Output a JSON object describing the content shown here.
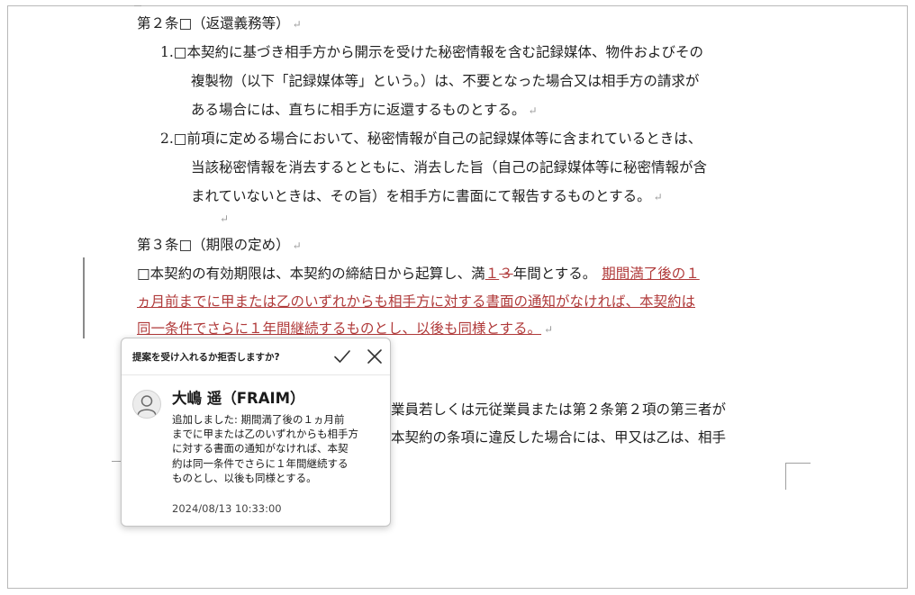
{
  "document": {
    "article2": {
      "heading": "第２条□（返還義務等）",
      "item1": {
        "number": "1.□",
        "lines": [
          "本契約に基づき相手方から開示を受けた秘密情報を含む記録媒体、物件およびその",
          "複製物（以下「記録媒体等」という。）は、不要となった場合又は相手方の請求が",
          "ある場合には、直ちに相手方に返還するものとする。"
        ]
      },
      "item2": {
        "number": "2.□",
        "lines": [
          "前項に定める場合において、秘密情報が自己の記録媒体等に含まれているときは、",
          "当該秘密情報を消去するとともに、消去した旨（自己の記録媒体等に秘密情報が含",
          "まれていないときは、その旨）を相手方に書面にて報告するものとする。"
        ]
      }
    },
    "article3": {
      "heading": "第３条□（期限の定め）",
      "line1_prefix": "□本契約の有効期限は、本契約の締結日から起算し、満",
      "line1_inserted_num": "１",
      "line1_deleted_num": "３",
      "line1_suffix": "年間とする。",
      "line1_inserted_tail": "期間満了後の１",
      "inserted_line2": "ヵ月前までに甲または乙のいずれからも相手方に対する書面の通知がなければ、本契約は",
      "inserted_line3": "同一条件でさらに１年間継続するものとし、以後も同様とする。"
    },
    "hidden_lines": [
      "業員若しくは元従業員または第２条第２項の第三者が",
      "本契約の条項に違反した場合には、甲又は乙は、相手"
    ],
    "paragraph_mark": "↵"
  },
  "popup": {
    "question": "提案を受け入れるか拒否しますか?",
    "accept_icon": "check-icon",
    "reject_icon": "close-icon",
    "author": "大嶋 遥（FRAIM）",
    "comment_lines": [
      "追加しました: 期間満了後の１ヵ月前",
      "までに甲または乙のいずれからも相手方",
      "に対する書面の通知がなければ、本契",
      "約は同一条件でさらに１年間継続する",
      "ものとし、以後も同様とする。"
    ],
    "timestamp": "2024/08/13 10:33:00"
  }
}
